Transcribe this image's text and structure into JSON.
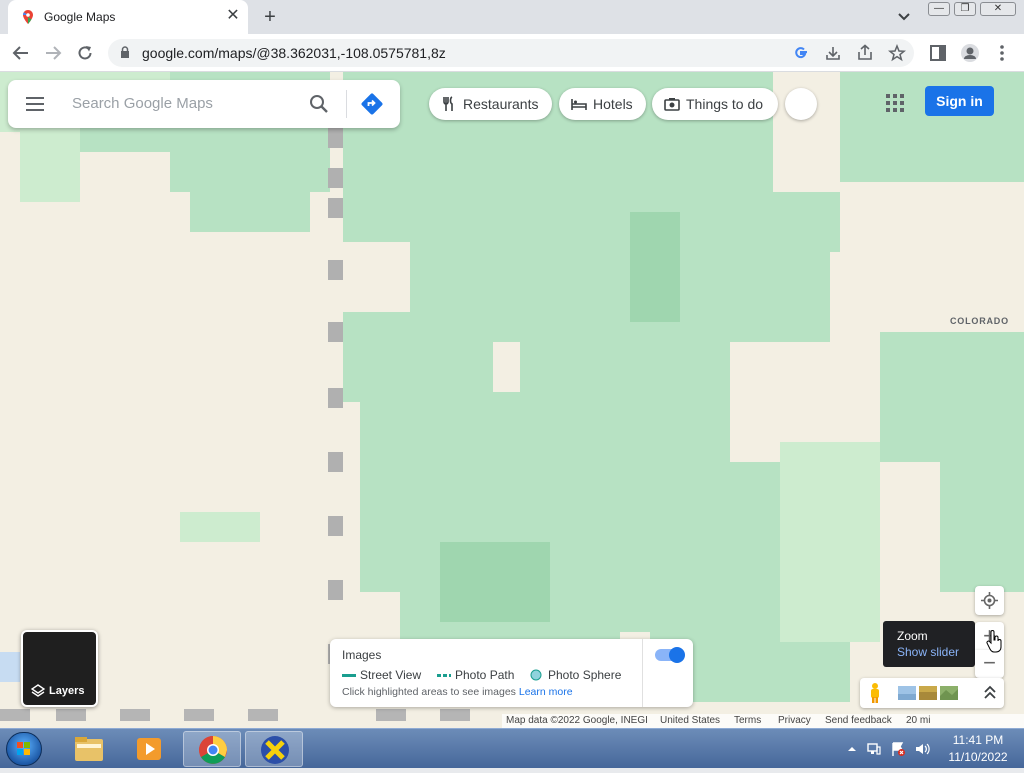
{
  "browser": {
    "tab_title": "Google Maps",
    "tab_close": "✕",
    "new_tab": "+",
    "url": "google.com/maps/@38.362031,-108.0575781,8z",
    "win_min": "—",
    "win_max": "❐",
    "win_close": "✕"
  },
  "search": {
    "placeholder": "Search Google Maps"
  },
  "chips": [
    {
      "label": "Restaurants",
      "icon": "fork-knife-icon"
    },
    {
      "label": "Hotels",
      "icon": "bed-icon"
    },
    {
      "label": "Things to do",
      "icon": "camera-icon"
    }
  ],
  "signin_label": "Sign in",
  "map": {
    "state_label": "COLORADO"
  },
  "layers": {
    "label": "Layers"
  },
  "images_panel": {
    "title": "Images",
    "legend": [
      {
        "label": "Street View",
        "color": "#1a9e8f"
      },
      {
        "label": "Photo Path",
        "color": "#1a9e8f"
      },
      {
        "label": "Photo Sphere",
        "color": "#8fd3dc"
      }
    ],
    "hint": "Click highlighted areas to see images",
    "learn_more": "Learn more",
    "toggle_on": true
  },
  "zoom_tooltip": {
    "title": "Zoom",
    "action": "Show slider"
  },
  "zoom": {
    "in": "+",
    "out": "−"
  },
  "attribution": {
    "map_data": "Map data ©2022 Google, INEGI",
    "country": "United States",
    "terms": "Terms",
    "privacy": "Privacy",
    "feedback": "Send feedback",
    "scale": "20 mi"
  },
  "taskbar": {
    "time": "11:41 PM",
    "date": "11/10/2022"
  },
  "colors": {
    "accent": "#1a73e8",
    "map_land": "#f3efe3",
    "map_green": "#b7e2c3"
  }
}
